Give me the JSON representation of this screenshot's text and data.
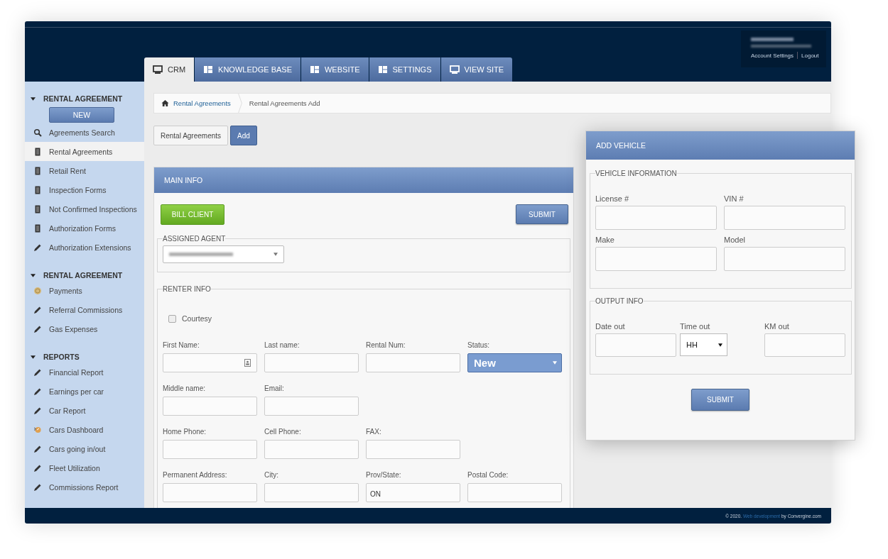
{
  "header": {
    "tabs": [
      {
        "label": "CRM",
        "kind": "monitor",
        "selected": true
      },
      {
        "label": "KNOWLEDGE BASE",
        "kind": "layout",
        "selected": false
      },
      {
        "label": "WEBSITE",
        "kind": "layout",
        "selected": false
      },
      {
        "label": "SETTINGS",
        "kind": "layout",
        "selected": false
      },
      {
        "label": "VIEW SITE",
        "kind": "monitor",
        "selected": false
      }
    ],
    "user_menu": {
      "links": [
        "Account Settings",
        "Logout"
      ]
    }
  },
  "sidebar": {
    "sections": [
      {
        "title": "RENTAL AGREEMENT",
        "expanded": true,
        "button": "NEW",
        "items": [
          {
            "label": "Agreements Search",
            "kind": "search",
            "selected": false
          },
          {
            "label": "Rental Agreements",
            "kind": "document",
            "selected": true
          },
          {
            "label": "Retail Rent",
            "kind": "document",
            "selected": false
          },
          {
            "label": "Inspection Forms",
            "kind": "document",
            "selected": false
          },
          {
            "label": "Not Confirmed Inspections",
            "kind": "document",
            "selected": false
          },
          {
            "label": "Authorization Forms",
            "kind": "document",
            "selected": false
          },
          {
            "label": "Authorization Extensions",
            "kind": "pencil",
            "selected": false
          }
        ]
      },
      {
        "title": "RENTAL AGREEMENT",
        "expanded": true,
        "items": [
          {
            "label": "Payments",
            "kind": "coin",
            "selected": false
          },
          {
            "label": "Referral Commissions",
            "kind": "pencil",
            "selected": false
          },
          {
            "label": "Gas Expenses",
            "kind": "pencil",
            "selected": false
          }
        ]
      },
      {
        "title": "REPORTS",
        "expanded": true,
        "items": [
          {
            "label": "Financial Report",
            "kind": "pencil",
            "selected": false
          },
          {
            "label": "Earnings per car",
            "kind": "pencil",
            "selected": false
          },
          {
            "label": "Car Report",
            "kind": "pencil",
            "selected": false
          },
          {
            "label": "Cars Dashboard",
            "kind": "dashboard",
            "selected": false
          },
          {
            "label": "Cars going in/out",
            "kind": "pencil",
            "selected": false
          },
          {
            "label": "Fleet Utilization",
            "kind": "pencil",
            "selected": false
          },
          {
            "label": "Commissions Report",
            "kind": "pencil",
            "selected": false
          }
        ]
      }
    ]
  },
  "breadcrumb": [
    "Rental Agreements",
    "Rental Agreements Add"
  ],
  "page_buttons": [
    {
      "label": "Rental Agreements",
      "selected": false
    },
    {
      "label": "Add",
      "selected": true
    }
  ],
  "main_info": {
    "title": "MAIN INFO",
    "bill_button": "BILL CLIENT",
    "submit_button": "SUBMIT",
    "assigned_agent": {
      "legend": "ASSIGNED AGENT"
    },
    "renter_info": {
      "legend": "RENTER INFO",
      "courtesy": {
        "label": "Courtesy",
        "checked": false
      },
      "rows": [
        [
          {
            "label": "First Name:",
            "kind": "contact"
          },
          {
            "label": "Last name:",
            "kind": "text"
          },
          {
            "label": "Rental Num:",
            "kind": "text"
          },
          {
            "label": "Status:",
            "kind": "select",
            "value": "New"
          }
        ],
        [
          {
            "label": "Middle name:",
            "kind": "text"
          },
          {
            "label": "Email:",
            "kind": "text"
          }
        ],
        [
          {
            "label": "Home Phone:",
            "kind": "text"
          },
          {
            "label": "Cell Phone:",
            "kind": "text"
          },
          {
            "label": "FAX:",
            "kind": "text"
          }
        ],
        [
          {
            "label": "Permanent Address:",
            "kind": "text"
          },
          {
            "label": "City:",
            "kind": "text"
          },
          {
            "label": "Prov/State:",
            "kind": "text",
            "value": "ON"
          },
          {
            "label": "Postal Code:",
            "kind": "text"
          }
        ]
      ]
    }
  },
  "dialog": {
    "title": "ADD VEHICLE",
    "fieldsets": [
      {
        "legend": "VEHICLE INFORMATION",
        "rows": [
          [
            {
              "label": "License #",
              "kind": "text"
            },
            {
              "label": "VIN #",
              "kind": "text"
            }
          ],
          [
            {
              "label": "Make",
              "kind": "text"
            },
            {
              "label": "Model",
              "kind": "text"
            }
          ]
        ]
      },
      {
        "legend": "OUTPUT INFO",
        "rows": [
          [
            {
              "label": "Date out",
              "kind": "text"
            },
            {
              "label": "Time out",
              "kind": "select",
              "value": "HH"
            },
            {
              "label": "KM out",
              "kind": "text"
            }
          ]
        ]
      }
    ],
    "submit_button": "SUBMIT"
  },
  "footer": {
    "copyright": "© 2020.",
    "link": "Web development",
    "suffix": "by Convergine.com"
  }
}
